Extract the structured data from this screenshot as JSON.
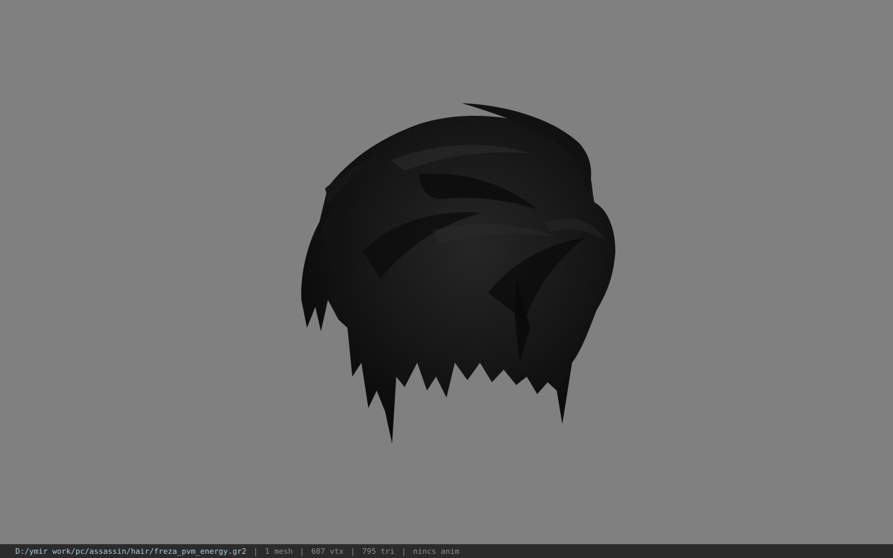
{
  "viewer": {
    "background_color": "#808080",
    "model_color": "#141414",
    "model_subject": "hair mesh"
  },
  "statusbar": {
    "path": "D:/ymir work/pc/assassin/hair/freza_pvm_energy.gr2",
    "separator": "|",
    "mesh_count": "1 mesh",
    "vertex_count": "607 vtx",
    "triangle_count": "795 tri",
    "anim": "nincs anim"
  }
}
